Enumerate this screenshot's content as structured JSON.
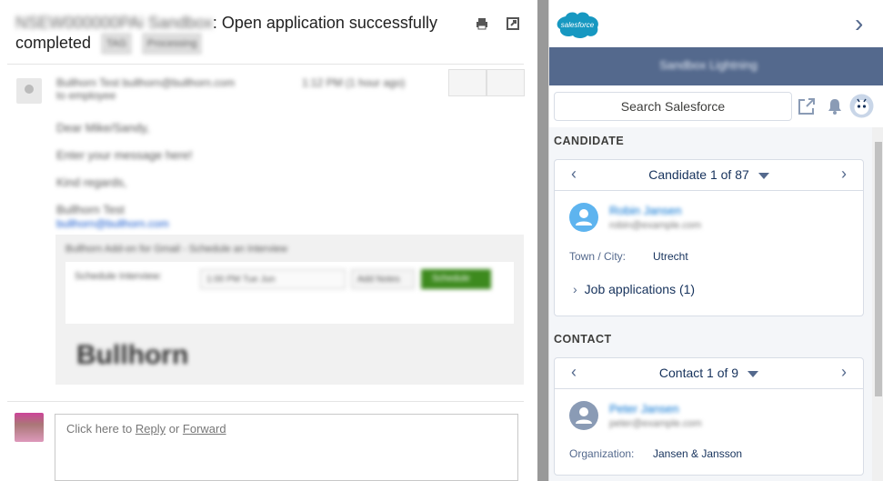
{
  "gmail": {
    "subject_prefix": "NSEW000000PAi Sandbox",
    "subject_text": ": Open application successfully completed",
    "subject_tags": [
      "TAG",
      "Processing"
    ],
    "sender_name": "Bullhorn Test",
    "sender_email": "bullhorn@bullhorn.com",
    "sender_to": "to employee",
    "sent_time": "1:12 PM (1 hour ago)",
    "body_lines": [
      "Dear Mike/Sandy,",
      "Enter your message here!",
      "Kind regards,",
      "Bullhorn Test"
    ],
    "signature_link": "bullhorn@bullhorn.com",
    "addin": {
      "title": "Bullhorn Add-on for Gmail - Schedule an Interview",
      "row_label": "Schedule Interview:",
      "select_value": "1:00 PM Tue Jun",
      "button1": "Add Notes",
      "button2": "Schedule"
    },
    "brand": "Bullhorn",
    "reply_prompt": "Click here to ",
    "reply_link": "Reply",
    "reply_or": " or ",
    "forward_link": "Forward"
  },
  "salesforce": {
    "logo_text": "salesforce",
    "banner_text": "Sandbox Lightning",
    "search_placeholder": "Search Salesforce",
    "candidate_section": "CANDIDATE",
    "candidate_pager": "Candidate 1 of 87",
    "candidate_name": "Robin Jansen",
    "candidate_email": "robin@example.com",
    "candidate_field_label": "Town / City:",
    "candidate_field_value": "Utrecht",
    "job_applications": "Job applications (1)",
    "contact_section": "CONTACT",
    "contact_pager": "Contact 1 of 9",
    "contact_name": "Peter Jansen",
    "contact_email": "peter@example.com",
    "contact_field_label": "Organization:",
    "contact_field_value": "Jansen & Jansson",
    "colors": {
      "banner": "#54698d",
      "link": "#0070d2",
      "avatar_candidate": "#5eb4ef",
      "avatar_contact": "#8a9bb5"
    }
  }
}
